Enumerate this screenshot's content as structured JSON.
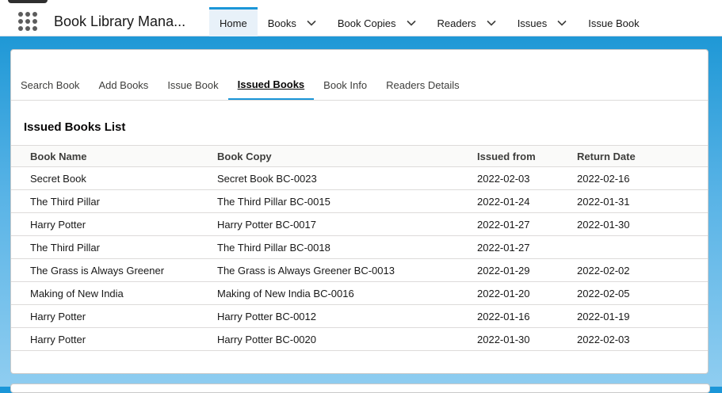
{
  "header": {
    "app_title": "Book Library Mana...",
    "nav": [
      {
        "label": "Home",
        "has_menu": false,
        "active": true
      },
      {
        "label": "Books",
        "has_menu": true
      },
      {
        "label": "Book Copies",
        "has_menu": true
      },
      {
        "label": "Readers",
        "has_menu": true
      },
      {
        "label": "Issues",
        "has_menu": true
      },
      {
        "label": "Issue Book",
        "has_menu": false
      }
    ]
  },
  "tabs": [
    {
      "label": "Search Book"
    },
    {
      "label": "Add Books"
    },
    {
      "label": "Issue Book"
    },
    {
      "label": "Issued Books",
      "active": true
    },
    {
      "label": "Book Info"
    },
    {
      "label": "Readers Details"
    }
  ],
  "list": {
    "title": "Issued Books List",
    "columns": [
      "Book Name",
      "Book Copy",
      "Issued from",
      "Return Date"
    ],
    "rows": [
      [
        "Secret Book",
        "Secret Book BC-0023",
        "2022-02-03",
        "2022-02-16"
      ],
      [
        "The Third Pillar",
        "The Third Pillar BC-0015",
        "2022-01-24",
        "2022-01-31"
      ],
      [
        "Harry Potter",
        "Harry Potter BC-0017",
        "2022-01-27",
        "2022-01-30"
      ],
      [
        "The Third Pillar",
        "The Third Pillar BC-0018",
        "2022-01-27",
        ""
      ],
      [
        "The Grass is Always Greener",
        "The Grass is Always Greener BC-0013",
        "2022-01-29",
        "2022-02-02"
      ],
      [
        "Making of New India",
        "Making of New India BC-0016",
        "2022-01-20",
        "2022-02-05"
      ],
      [
        "Harry Potter",
        "Harry Potter BC-0012",
        "2022-01-16",
        "2022-01-19"
      ],
      [
        "Harry Potter",
        "Harry Potter BC-0020",
        "2022-01-30",
        "2022-02-03"
      ]
    ]
  },
  "colors": {
    "brand_blue": "#1b96d8",
    "active_nav_bg": "#e8f1f9"
  }
}
